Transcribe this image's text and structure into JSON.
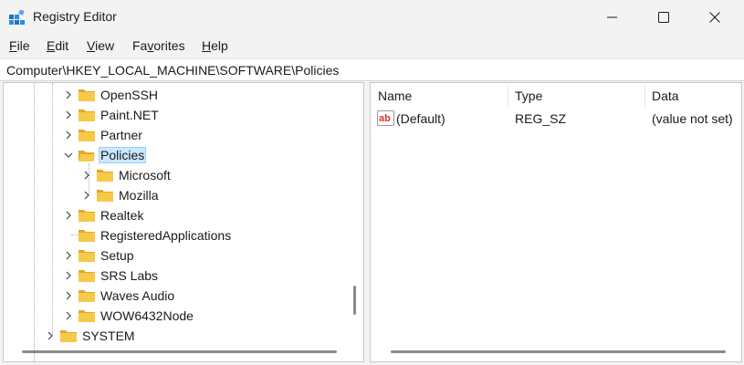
{
  "window": {
    "title": "Registry Editor",
    "icon": "registry-editor-icon",
    "controls": {
      "minimize": "minimize-icon",
      "maximize": "maximize-icon",
      "close": "close-icon"
    }
  },
  "menu": {
    "items": [
      {
        "accel": "F",
        "rest": "ile"
      },
      {
        "accel": "E",
        "rest": "dit"
      },
      {
        "accel": "V",
        "rest": "iew"
      },
      {
        "accel": "",
        "rest": "Fa",
        "accel2": "v",
        "rest2": "orites"
      },
      {
        "accel": "H",
        "rest": "elp"
      }
    ]
  },
  "address": {
    "path": "Computer\\HKEY_LOCAL_MACHINE\\SOFTWARE\\Policies"
  },
  "tree": {
    "items": [
      {
        "label": "OpenSSH",
        "expanded": false
      },
      {
        "label": "Paint.NET",
        "expanded": false
      },
      {
        "label": "Partner",
        "expanded": false
      },
      {
        "label": "Policies",
        "expanded": true,
        "selected": true
      },
      {
        "label": "Microsoft",
        "expanded": false
      },
      {
        "label": "Mozilla",
        "expanded": false
      },
      {
        "label": "Realtek",
        "expanded": false
      },
      {
        "label": "RegisteredApplications",
        "expanded": false,
        "leaf": true
      },
      {
        "label": "Setup",
        "expanded": false
      },
      {
        "label": "SRS Labs",
        "expanded": false
      },
      {
        "label": "Waves Audio",
        "expanded": false
      },
      {
        "label": "WOW6432Node",
        "expanded": false
      },
      {
        "label": "SYSTEM",
        "expanded": false
      }
    ]
  },
  "list": {
    "columns": [
      "Name",
      "Type",
      "Data"
    ],
    "rows": [
      {
        "icon": "string-value-icon",
        "name": "(Default)",
        "type": "REG_SZ",
        "data": "(value not set)"
      }
    ]
  },
  "colors": {
    "selection_bg": "#cce8ff",
    "selection_border": "#99d1ff",
    "folder": "#f7c948"
  }
}
